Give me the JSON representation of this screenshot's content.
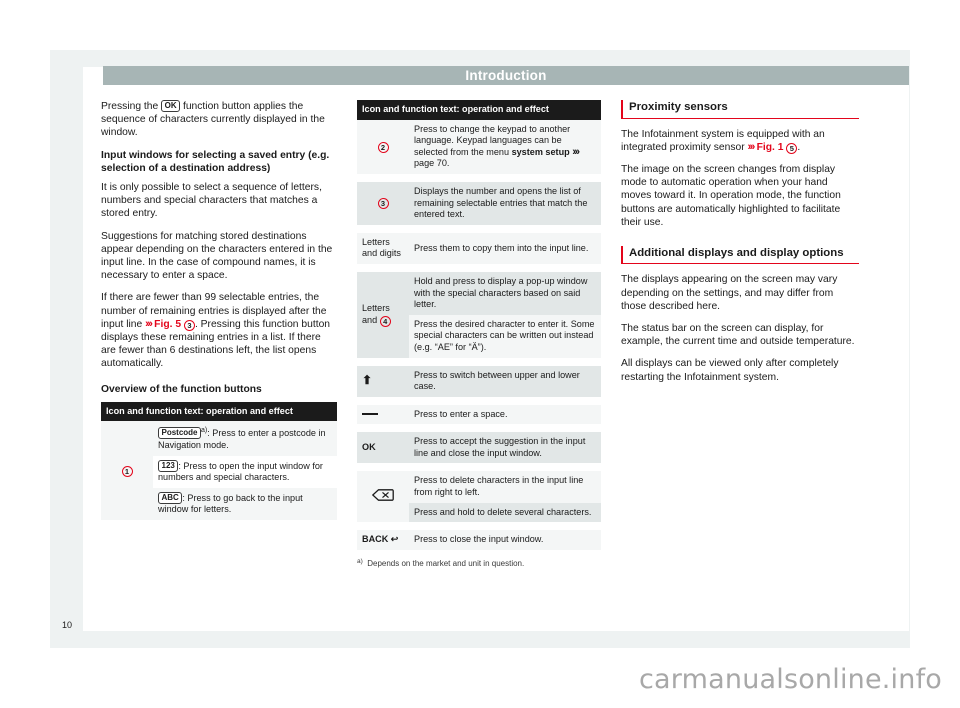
{
  "document": {
    "header_title": "Introduction",
    "page_number": "10",
    "watermark": "carmanualsonline.info"
  },
  "left_column": {
    "paragraphs": [
      {
        "type": "rich",
        "parts": [
          {
            "t": "text",
            "v": "Pressing the "
          },
          {
            "t": "keycap",
            "v": "OK"
          },
          {
            "t": "text",
            "v": " function button applies the sequence of characters currently displayed in the window."
          }
        ]
      }
    ],
    "subhead_1": "Input windows for selecting a saved entry (e.g. selection of a destination address)",
    "para_2": "It is only possible to select a sequence of letters, numbers and special characters that matches a stored entry.",
    "para_3": "Suggestions for matching stored destinations appear depending on the characters entered in the input line. In the case of compound names, it is necessary to enter a space.",
    "para_4_pre": "If there are fewer than 99 selectable entries, the number of remaining entries is displayed after the input line ",
    "para_4_ref": "Fig. 5",
    "para_4_circ": "3",
    "para_4_post": ". Pressing this function button displays these remaining entries in a list. If there are fewer than 6 destinations left, the list opens automatically.",
    "subhead_2": "Overview of the function buttons",
    "table": {
      "header": "Icon and function text: operation and effect",
      "rows": [
        {
          "icon_circle": "1",
          "lines": [
            {
              "keycap": "Postcode",
              "sup": "a)",
              "text": ": Press to enter a postcode in Navigation mode."
            },
            {
              "keycap": "123",
              "sup": "",
              "text": ": Press to open the input window for numbers and special characters."
            },
            {
              "keycap": "ABC",
              "sup": "",
              "text": ": Press to go back to the input window for letters."
            }
          ]
        }
      ]
    }
  },
  "mid_column": {
    "table": {
      "header": "Icon and function text: operation and effect",
      "rows": [
        {
          "icon_type": "circle",
          "icon": "2",
          "cells": [
            {
              "pre": "Press to change the keypad to another language. Keypad languages can be selected from the menu ",
              "bold": "system setup",
              "arrows": true,
              "post": " page 70."
            }
          ]
        },
        {
          "icon_type": "circle",
          "icon": "3",
          "cells": [
            {
              "pre": "Displays the number and opens the list of remaining selectable entries that match the entered text."
            }
          ]
        },
        {
          "icon_type": "text",
          "icon": "Letters and digits",
          "cells": [
            {
              "pre": "Press them to copy them into the input line."
            }
          ]
        },
        {
          "icon_type": "text-circle",
          "icon": "Letters and ",
          "icon_circle": "4",
          "cells": [
            {
              "pre": "Hold and press to display a pop-up window with the special characters based on said letter."
            },
            {
              "pre": "Press the desired character to enter it. Some special characters can be written out instead (e.g. “AE” for “Ä”)."
            }
          ]
        },
        {
          "icon_type": "shift",
          "icon": "⬆",
          "cells": [
            {
              "pre": "Press to switch between upper and lower case."
            }
          ]
        },
        {
          "icon_type": "space",
          "icon": "space-bar",
          "cells": [
            {
              "pre": "Press to enter a space."
            }
          ]
        },
        {
          "icon_type": "text",
          "icon": "OK",
          "cells": [
            {
              "pre": "Press to accept the suggestion in the input line and close the input window."
            }
          ]
        },
        {
          "icon_type": "backspace",
          "icon": "backspace",
          "cells": [
            {
              "pre": "Press to delete characters in the input line from right to left."
            },
            {
              "pre": "Press and hold to delete several characters."
            }
          ]
        },
        {
          "icon_type": "back",
          "icon": "BACK ↩",
          "cells": [
            {
              "pre": "Press to close the input window."
            }
          ]
        }
      ],
      "footnote_mark": "a)",
      "footnote_text": "Depends on the market and unit in question."
    }
  },
  "right_column": {
    "section_1": {
      "heading": "Proximity sensors",
      "para_1_pre": "The Infotainment system is equipped with an integrated proximity sensor ",
      "para_1_ref": "Fig. 1",
      "para_1_circ": "5",
      "para_1_post": ".",
      "para_2": "The image on the screen changes from display mode to automatic operation when your hand moves toward it. In operation mode, the function buttons are automatically highlighted to facilitate their use."
    },
    "section_2": {
      "heading": "Additional displays and display options",
      "para_1": "The displays appearing on the screen may vary depending on the settings, and may differ from those described here.",
      "para_2": "The status bar on the screen can display, for example, the current time and outside temperature.",
      "para_3": "All displays can be viewed only after completely restarting the Infotainment system."
    }
  },
  "colors": {
    "accent_red": "#e3051b",
    "header_bar": "#a7b5b5",
    "table_header_bg": "#1b1b1b",
    "row_light": "#f4f6f6",
    "row_dark": "#e2e7e7",
    "page_frame": "#eef2f2"
  }
}
